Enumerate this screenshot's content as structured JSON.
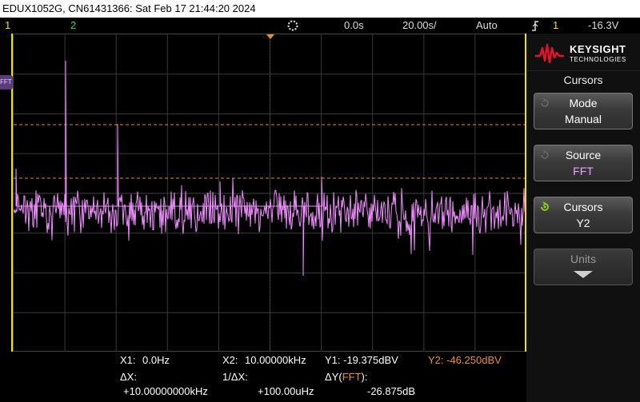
{
  "title_bar": {
    "text": "EDUX1052G, CN61431366: Sat Feb 17 21:44:20 2024"
  },
  "status": {
    "ch1_label": "1",
    "ch2_label": "2",
    "run_icon": "run-stop-icon",
    "time_offset": "0.0s",
    "time_scale": "20.00s/",
    "trigger_mode": "Auto",
    "trigger_icon": "trigger-slope-icon",
    "trigger_channel": "1",
    "trigger_level": "-16.3V"
  },
  "logo": {
    "brand": "KEYSIGHT",
    "sub": "TECHNOLOGIES"
  },
  "menu": {
    "title": "Cursors",
    "softkeys": [
      {
        "label": "Mode",
        "value": "Manual"
      },
      {
        "label": "Source",
        "value": "FFT"
      },
      {
        "label": "Cursors",
        "value": "Y2"
      },
      {
        "label": "Units",
        "value": ""
      }
    ]
  },
  "waveform_label": "FFT",
  "cursors": {
    "x1": "X1:",
    "x1_val": "0.0Hz",
    "x2": "X2:",
    "x2_val": "10.00000kHz",
    "y1": "Y1: -19.375dBV",
    "y2": "Y2: -46.250dBV",
    "dx_label": "ΔX:",
    "dx_val": "+10.00000000kHz",
    "inv_dx_label": "1/ΔX:",
    "inv_dx_val": "+100.00uHz",
    "dy_label": "ΔY(",
    "dy_src": "FFT",
    "dy_label_end": "):",
    "dy_val": "-26.875dB"
  },
  "colors": {
    "fft_trace": "#f08cff",
    "cursor_line": "#e08a30",
    "ch1": "#f2e200",
    "ch2": "#44d24a",
    "accent_green": "#8fd820",
    "brand_red": "#e8112d"
  }
}
